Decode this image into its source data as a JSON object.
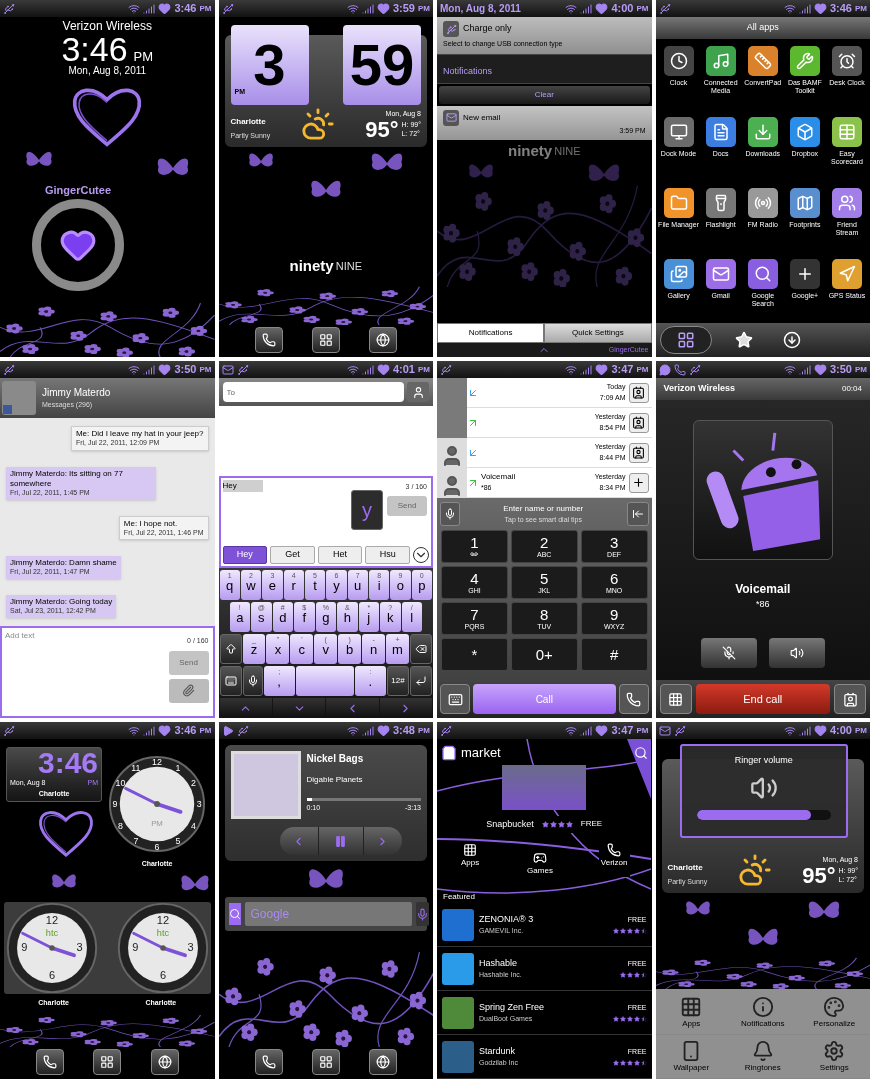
{
  "screens": [
    {
      "kind": "lock",
      "status": {
        "time": "3:46",
        "meridiem": "PM"
      },
      "carrier": "Verizon Wireless",
      "time": "3:46",
      "meridiem": "PM",
      "date": "Mon, Aug 8, 2011",
      "ring_label": "GingerCutee"
    },
    {
      "kind": "home_weather",
      "status": {
        "time": "3:59",
        "meridiem": "PM"
      },
      "clock": {
        "hour": "3",
        "minute": "59",
        "meridiem": "PM"
      },
      "weather": {
        "city": "Charlotte",
        "condition": "Partly Sunny",
        "date": "Mon, Aug 8",
        "temp": "95°",
        "high": "H: 99°",
        "low": "L: 72°"
      },
      "logo": [
        "ninety",
        "NINE"
      ]
    },
    {
      "kind": "notifications",
      "status": {
        "date": "Mon, Aug 8, 2011",
        "time": "4:00",
        "meridiem": "PM"
      },
      "ongoing": {
        "title": "Charge only",
        "text": "Select to change USB connection type"
      },
      "header": "Notifications",
      "clear": "Clear",
      "items": [
        {
          "title": "New email",
          "time": "3:59 PM"
        }
      ],
      "logo": [
        "ninety",
        "NINE"
      ],
      "tabs": [
        {
          "label": "Notifications",
          "selected": true
        },
        {
          "label": "Quick Settings",
          "selected": false
        }
      ],
      "brand": "GingerCutee"
    },
    {
      "kind": "all_apps",
      "status": {
        "time": "3:46",
        "meridiem": "PM"
      },
      "title": "All apps",
      "apps": [
        {
          "name": "Clock",
          "kind": "clock",
          "color": "#444444"
        },
        {
          "name": "Connected Media",
          "kind": "media",
          "color": "#3fa34d"
        },
        {
          "name": "ConvertPad",
          "kind": "ruler",
          "color": "#d9822b"
        },
        {
          "name": "Das BAMF Toolkit",
          "kind": "wrench",
          "color": "#5cb82e"
        },
        {
          "name": "Desk Clock",
          "kind": "deskclock",
          "color": "#555555"
        },
        {
          "name": "Dock Mode",
          "kind": "dock",
          "color": "#6b6b6b"
        },
        {
          "name": "Docs",
          "kind": "docs",
          "color": "#3b7de0"
        },
        {
          "name": "Downloads",
          "kind": "download",
          "color": "#4caf50"
        },
        {
          "name": "Dropbox",
          "kind": "box",
          "color": "#2a8ee8"
        },
        {
          "name": "Easy Scorecard",
          "kind": "table",
          "color": "#8bc34a"
        },
        {
          "name": "File Manager",
          "kind": "folder",
          "color": "#f0932b"
        },
        {
          "name": "Flashlight",
          "kind": "flashlight",
          "color": "#777777"
        },
        {
          "name": "FM Radio",
          "kind": "radio",
          "color": "#999999"
        },
        {
          "name": "Footprints",
          "kind": "map",
          "color": "#5a8fcf"
        },
        {
          "name": "Friend Stream",
          "kind": "users",
          "color": "#a27ee8"
        },
        {
          "name": "Gallery",
          "kind": "gallery",
          "color": "#4a90d9"
        },
        {
          "name": "Gmail",
          "kind": "mail",
          "color": "#9b6ee8"
        },
        {
          "name": "Google Search",
          "kind": "search",
          "color": "#8a5ee0"
        },
        {
          "name": "Google+",
          "kind": "plus",
          "color": "#333333"
        },
        {
          "name": "GPS Status",
          "kind": "gps",
          "color": "#e0a030"
        }
      ],
      "tabs": [
        {
          "kind": "grid",
          "selected": true
        },
        {
          "kind": "star",
          "selected": false
        },
        {
          "kind": "download",
          "selected": false
        }
      ]
    },
    {
      "kind": "conversation",
      "status": {
        "time": "3:50",
        "meridiem": "PM"
      },
      "contact": "Jimmy Materdo",
      "subtitle": "Messages (296)",
      "messages": [
        {
          "kind": "sent",
          "text": "Me: Did I leave my hat in your jeep?",
          "time": "Fri, Jul 22, 2011, 12:09 PM"
        },
        {
          "kind": "received",
          "text": "Jimmy Materdo: Its sitting on 77 somewhere",
          "time": "Fri, Jul 22, 2011, 1:45 PM"
        },
        {
          "kind": "sent",
          "text": "Me: I hope not.",
          "time": "Fri, Jul 22, 2011, 1:46 PM"
        },
        {
          "kind": "received",
          "text": "Jimmy Materdo: Damn shame",
          "time": "Fri, Jul 22, 2011, 1:47 PM"
        },
        {
          "kind": "received",
          "text": "Jimmy Materdo: Going today",
          "time": "Sat, Jul 23, 2011, 12:42 PM"
        }
      ],
      "input": {
        "placeholder": "Add text",
        "counter": "0 / 160"
      },
      "send": {
        "label": "Send",
        "disabled": true
      }
    },
    {
      "kind": "compose",
      "status": {
        "time": "4:01",
        "meridiem": "PM"
      },
      "to": {
        "placeholder": "To"
      },
      "message": {
        "value": "Hey",
        "counter": "3 / 160"
      },
      "send": {
        "label": "Send",
        "disabled": true
      },
      "suggestions": [
        {
          "label": "Hey",
          "selected": true
        },
        {
          "label": "Get",
          "selected": false
        },
        {
          "label": "Het",
          "selected": false
        },
        {
          "label": "Hsu",
          "selected": false
        }
      ],
      "key_preview": "y",
      "keyboard": [
        [
          {
            "kind": "char",
            "label": "q",
            "hint": "1"
          },
          {
            "kind": "char",
            "label": "w",
            "hint": "2"
          },
          {
            "kind": "char",
            "label": "e",
            "hint": "3"
          },
          {
            "kind": "char",
            "label": "r",
            "hint": "4"
          },
          {
            "kind": "char",
            "label": "t",
            "hint": "5"
          },
          {
            "kind": "char",
            "label": "y",
            "hint": "6"
          },
          {
            "kind": "char",
            "label": "u",
            "hint": "7"
          },
          {
            "kind": "char",
            "label": "i",
            "hint": "8"
          },
          {
            "kind": "char",
            "label": "o",
            "hint": "9"
          },
          {
            "kind": "char",
            "label": "p",
            "hint": "0"
          }
        ],
        [
          {
            "kind": "char",
            "label": "a",
            "hint": "!"
          },
          {
            "kind": "char",
            "label": "s",
            "hint": "@"
          },
          {
            "kind": "char",
            "label": "d",
            "hint": "#"
          },
          {
            "kind": "char",
            "label": "f",
            "hint": "$"
          },
          {
            "kind": "char",
            "label": "g",
            "hint": "%"
          },
          {
            "kind": "char",
            "label": "h",
            "hint": "&"
          },
          {
            "kind": "char",
            "label": "j",
            "hint": "*"
          },
          {
            "kind": "char",
            "label": "k",
            "hint": "?"
          },
          {
            "kind": "char",
            "label": "l",
            "hint": "/"
          }
        ],
        [
          {
            "kind": "shift"
          },
          {
            "kind": "char",
            "label": "z",
            "hint": "_"
          },
          {
            "kind": "char",
            "label": "x",
            "hint": "\""
          },
          {
            "kind": "char",
            "label": "c",
            "hint": "'"
          },
          {
            "kind": "char",
            "label": "v",
            "hint": "("
          },
          {
            "kind": "char",
            "label": "b",
            "hint": ")"
          },
          {
            "kind": "char",
            "label": "n",
            "hint": "-"
          },
          {
            "kind": "char",
            "label": "m",
            "hint": "+"
          },
          {
            "kind": "backspace"
          }
        ],
        [
          {
            "kind": "layout"
          },
          {
            "kind": "mic"
          },
          {
            "kind": "char",
            "label": ",",
            "hint": ";"
          },
          {
            "kind": "space"
          },
          {
            "kind": "char",
            "label": ".",
            "hint": ":"
          },
          {
            "kind": "symbols",
            "label": "12#"
          },
          {
            "kind": "enter"
          }
        ]
      ]
    },
    {
      "kind": "dialer",
      "status": {
        "time": "3:47",
        "meridiem": "PM"
      },
      "calls": [
        {
          "kind": "incoming",
          "has_photo": true,
          "day": "Today",
          "time": "7:09 AM",
          "in_contacts": true
        },
        {
          "kind": "outgoing",
          "has_photo": true,
          "day": "Yesterday",
          "time": "8:54 PM",
          "in_contacts": true
        },
        {
          "kind": "incoming",
          "has_photo": false,
          "day": "Yesterday",
          "time": "8:44 PM",
          "in_contacts": true
        },
        {
          "kind": "outgoing",
          "has_photo": false,
          "name": "Voicemail",
          "number": "*86",
          "day": "Yesterday",
          "time": "8:34 PM",
          "in_contacts": false
        }
      ],
      "search": {
        "title": "Enter name or number",
        "hint": "Tap to see smart dial tips"
      },
      "keys": [
        {
          "digit": "1",
          "kind": "voicemail"
        },
        {
          "digit": "2",
          "letters": "ABC"
        },
        {
          "digit": "3",
          "letters": "DEF"
        },
        {
          "digit": "4",
          "letters": "GHI"
        },
        {
          "digit": "5",
          "letters": "JKL"
        },
        {
          "digit": "6",
          "letters": "MNO"
        },
        {
          "digit": "7",
          "letters": "PQRS"
        },
        {
          "digit": "8",
          "letters": "TUV"
        },
        {
          "digit": "9",
          "letters": "WXYZ"
        },
        {
          "digit": "*"
        },
        {
          "digit": "0+"
        },
        {
          "digit": "#"
        }
      ],
      "call": "Call"
    },
    {
      "kind": "in_call",
      "status": {
        "time": "3:50",
        "meridiem": "PM"
      },
      "carrier": "Verizon Wireless",
      "duration": "00:04",
      "name": "Voicemail",
      "number": "*86",
      "end": "End call"
    },
    {
      "kind": "home_clocks",
      "status": {
        "time": "3:46",
        "meridiem": "PM"
      },
      "digital": {
        "time": "3:46",
        "date": "Mon, Aug 8",
        "meridiem": "PM",
        "city": "Charlotte"
      },
      "analog": {
        "numerals": [
          "12",
          "1",
          "2",
          "3",
          "4",
          "5",
          "6",
          "7",
          "8",
          "9",
          "10",
          "11"
        ],
        "meridiem": "PM",
        "city": "Charlotte"
      },
      "dual": [
        {
          "numerals": [
            "12",
            "3",
            "6",
            "9"
          ],
          "brand": "htc",
          "city": "Charlotte"
        },
        {
          "numerals": [
            "12",
            "3",
            "6",
            "9"
          ],
          "brand": "htc",
          "city": "Charlotte"
        }
      ]
    },
    {
      "kind": "home_music",
      "status": {
        "time": "3:48",
        "meridiem": "PM"
      },
      "track": "Nickel Bags",
      "artist": "Digable Planets",
      "elapsed": "0:10",
      "remaining": "-3:13",
      "level": 0.05,
      "search": {
        "placeholder": "Google"
      }
    },
    {
      "kind": "market",
      "status": {
        "time": "3:47",
        "meridiem": "PM"
      },
      "title": "market",
      "banner": {
        "name": "Snapbucket",
        "stars": 4,
        "price": "FREE"
      },
      "nav": [
        {
          "kind": "apps",
          "label": "Apps"
        },
        {
          "kind": "games",
          "label": "Games"
        },
        {
          "kind": "phone",
          "label": "Verizon"
        }
      ],
      "section": "Featured",
      "apps": [
        {
          "name": "ZENONIA® 3",
          "developer": "GAMEVIL Inc.",
          "price": "FREE",
          "stars": 4.5,
          "color": "#1e6fd0"
        },
        {
          "name": "Hashable",
          "developer": "Hashable Inc.",
          "price": "FREE",
          "stars": 3.5,
          "color": "#2a9be8"
        },
        {
          "name": "Spring Zen Free",
          "developer": "DualBoot Games",
          "price": "FREE",
          "stars": 4.5,
          "color": "#4f8a3a"
        },
        {
          "name": "Stardunk",
          "developer": "Godzilab Inc",
          "price": "FREE",
          "stars": 4.5,
          "color": "#2b5f8a"
        }
      ]
    },
    {
      "kind": "volume",
      "status": {
        "time": "4:00",
        "meridiem": "PM"
      },
      "dialog": {
        "title": "Ringer volume",
        "level": 0.85
      },
      "weather": {
        "city": "Charlotte",
        "condition": "Partly Sunny",
        "date": "Mon, Aug 8",
        "temp": "95°",
        "high": "H: 99°",
        "low": "L: 72°"
      },
      "menu": [
        {
          "kind": "apps",
          "label": "Apps"
        },
        {
          "kind": "info",
          "label": "Notifications"
        },
        {
          "kind": "palette",
          "label": "Personalize"
        },
        {
          "kind": "wallpaper",
          "label": "Wallpaper"
        },
        {
          "kind": "bell",
          "label": "Ringtones"
        },
        {
          "kind": "settings",
          "label": "Settings"
        }
      ]
    }
  ]
}
